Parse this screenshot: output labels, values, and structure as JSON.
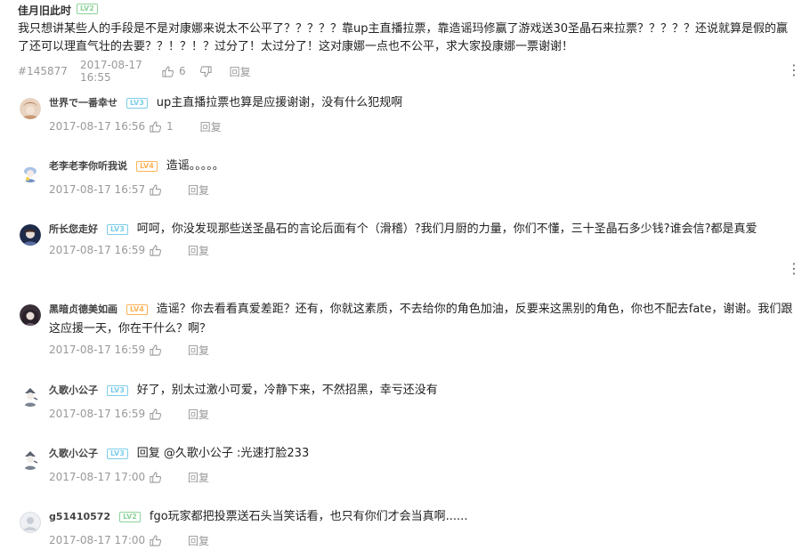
{
  "main_comment": {
    "username": "佳月旧此时",
    "level": "LV2",
    "text": "我只想讲某些人的手段是不是对康娜来说太不公平了？？？？？靠up主直播拉票，靠造谣玛修赢了游戏送30圣晶石来拉票？？？？？还说就算是假的赢了还可以理直气壮的去要？？！？！？过分了！太过分了！这对康娜一点也不公平，求大家投康娜一票谢谢！",
    "floor": "#145877",
    "time": "2017-08-17 16:55",
    "likes": "6",
    "reply_label": "回复"
  },
  "replies": [
    {
      "username": "世界で一番幸せ",
      "level": "LV3",
      "text": "up主直播拉票也算是应援谢谢，没有什么犯规啊",
      "time": "2017-08-17 16:56",
      "likes": "1",
      "reply_label": "回复",
      "avatar_color": "#d9b89a"
    },
    {
      "username": "老李老李你听我说",
      "level": "LV4",
      "text": "造谣。。。。。",
      "time": "2017-08-17 16:57",
      "likes": "",
      "reply_label": "回复",
      "avatar_color": "#a9c3e6"
    },
    {
      "username": "所长您走好",
      "level": "LV3",
      "text": "呵呵，你没发现那些送圣晶石的言论后面有个（滑稽）?我们月厨的力量，你们不懂，三十圣晶石多少钱?谁会信?都是真爱",
      "time": "2017-08-17 16:59",
      "likes": "",
      "reply_label": "回复",
      "avatar_color": "#2e3f66"
    },
    {
      "username": "黑暗贞德美如画",
      "level": "LV4",
      "text": "造谣？你去看看真爱差距？还有，你就这素质，不去给你的角色加油，反要来这黑别的角色，你也不配去fate，谢谢。我们跟这应援一天，你在干什么？啊？",
      "time": "2017-08-17 16:59",
      "likes": "",
      "reply_label": "回复",
      "avatar_color": "#4a3a45"
    },
    {
      "username": "久歌小公子",
      "level": "LV3",
      "text": "好了，别太过激小可爱，冷静下来，不然招黑，幸亏还没有",
      "time": "2017-08-17 16:59",
      "likes": "",
      "reply_label": "回复",
      "avatar_color": "#9aa4b0"
    },
    {
      "username": "久歌小公子",
      "level": "LV3",
      "text": "回复 @久歌小公子 :光速打脸233",
      "time": "2017-08-17 17:00",
      "likes": "",
      "reply_label": "回复",
      "avatar_color": "#9aa4b0"
    },
    {
      "username": "g51410572",
      "level": "LV2",
      "text": "fgo玩家都把投票送石头当笑话看，也只有你们才会当真啊......",
      "time": "2017-08-17 17:00",
      "likes": "",
      "reply_label": "回复",
      "avatar_color": "#dfe3e8"
    }
  ],
  "icons": {
    "like": "thumbs-up-icon",
    "dislike": "thumbs-down-icon",
    "more": "more-vertical-icon"
  },
  "colors": {
    "meta_text": "#999999",
    "lv2": "#8bd29b",
    "lv3": "#7bcde9",
    "lv4": "#feb356"
  }
}
